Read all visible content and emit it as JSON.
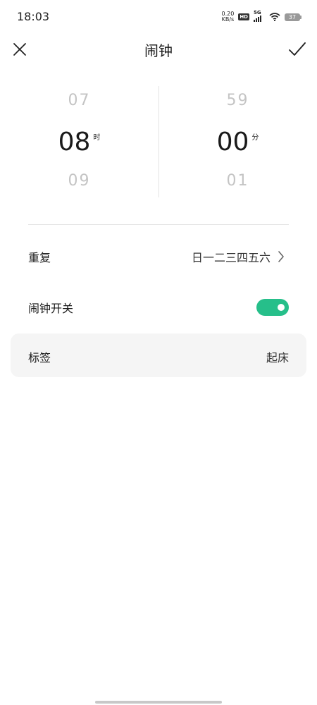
{
  "status_bar": {
    "time": "18:03",
    "speed_value": "0.20",
    "speed_unit": "KB/s",
    "hd_badge": "HD",
    "network": "5G",
    "battery": "37",
    "icons": [
      "hd-icon",
      "signal-icon",
      "wifi-icon",
      "battery-icon"
    ]
  },
  "header": {
    "title": "闹钟",
    "close_icon": "close-icon",
    "confirm_icon": "check-icon"
  },
  "picker": {
    "hour": {
      "prev": "07",
      "selected": "08",
      "next": "09",
      "unit": "时"
    },
    "minute": {
      "prev": "59",
      "selected": "00",
      "next": "01",
      "unit": "分"
    }
  },
  "settings": {
    "repeat": {
      "label": "重复",
      "value": "日一二三四五六",
      "icon": "chevron-right-icon"
    },
    "alarm_switch": {
      "label": "闹钟开关",
      "on": true
    },
    "tag": {
      "label": "标签",
      "value": "起床"
    }
  },
  "colors": {
    "accent": "#26bf8a",
    "card_bg": "#f5f5f5",
    "dim_text": "#c4c4c4"
  }
}
